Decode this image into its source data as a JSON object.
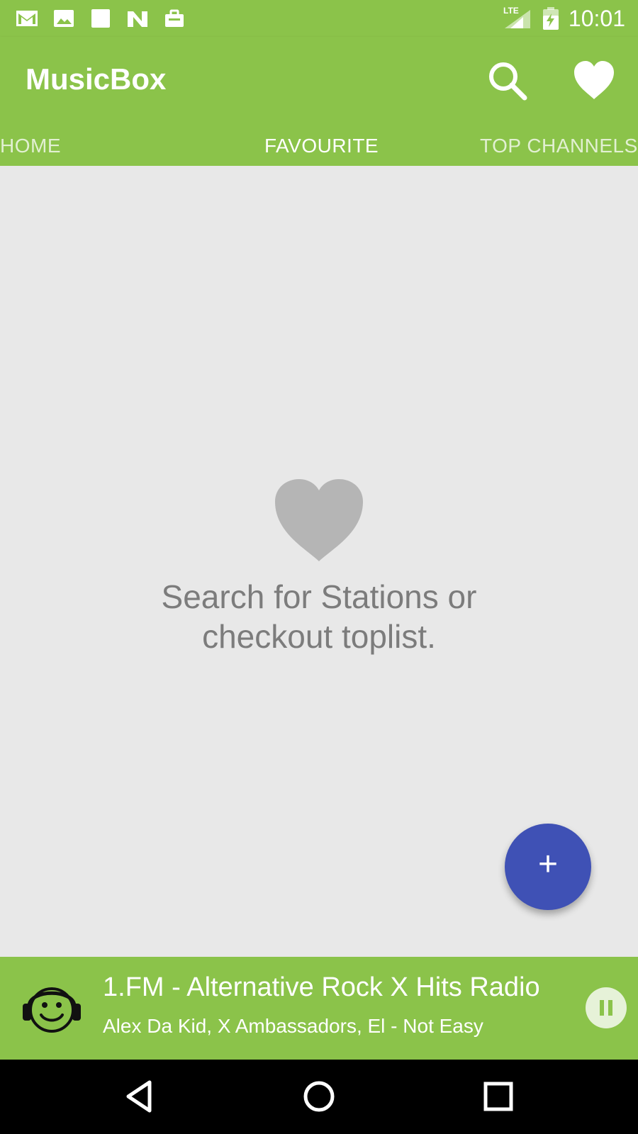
{
  "status_bar": {
    "time": "10:01",
    "network": "LTE",
    "icons": [
      "gmail-icon",
      "image-icon",
      "square-app-icon",
      "n-app-icon",
      "briefcase-icon",
      "signal-icon",
      "battery-charging-icon"
    ]
  },
  "toolbar": {
    "title": "MusicBox",
    "actions": [
      "search-icon",
      "heart-icon"
    ]
  },
  "tabs": [
    {
      "label": "HOME",
      "active": false
    },
    {
      "label": "FAVOURITE",
      "active": true
    },
    {
      "label": "TOP CHANNELS",
      "active": false
    }
  ],
  "empty_state": {
    "icon": "heart-icon",
    "message_line1": "Search for Stations or",
    "message_line2": "checkout toplist."
  },
  "fab": {
    "label": "+",
    "icon": "add-icon"
  },
  "player": {
    "station": "1.FM - Alternative Rock X Hits Radio",
    "track": "Alex Da Kid, X Ambassadors, El - Not Easy",
    "state_icon": "pause-icon"
  },
  "nav_bar": {
    "buttons": [
      "back-icon",
      "home-icon",
      "recents-icon"
    ]
  },
  "colors": {
    "primary": "#8bc34a",
    "accent": "#3f51b5",
    "background": "#e8e8e8",
    "empty_icon": "#b5b5b5",
    "empty_text": "#7c7c7c"
  }
}
